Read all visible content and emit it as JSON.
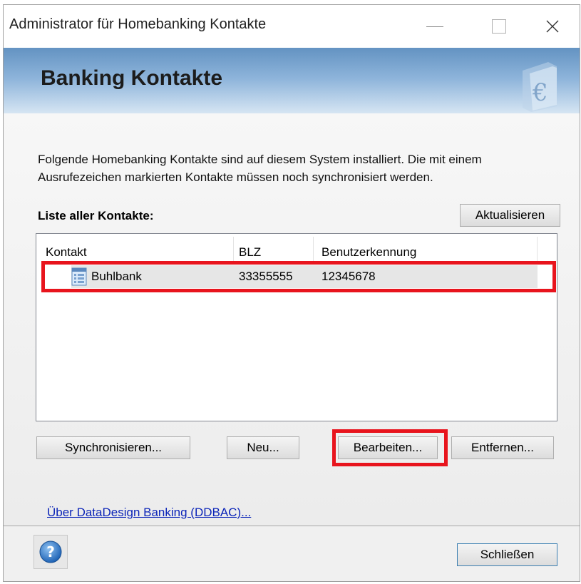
{
  "window": {
    "title": "Administrator für Homebanking Kontakte",
    "controls": {
      "minimize_icon": "minimize-icon",
      "maximize_icon": "maximize-icon",
      "close_icon": "close-icon"
    }
  },
  "header": {
    "title": "Banking Kontakte",
    "logo_icon": "euro-document-icon"
  },
  "intro_text": "Folgende Homebanking Kontakte sind auf diesem System installiert. Die mit einem Ausrufezeichen markierten Kontakte müssen noch synchronisiert werden.",
  "list": {
    "label": "Liste aller Kontakte:",
    "refresh_label": "Aktualisieren",
    "columns": [
      "Kontakt",
      "BLZ",
      "Benutzerkennung"
    ],
    "rows": [
      {
        "contact": "Buhlbank",
        "blz": "33355555",
        "user_id": "12345678",
        "icon": "contact-card-icon"
      }
    ]
  },
  "actions": {
    "sync_label": "Synchronisieren...",
    "new_label": "Neu...",
    "edit_label": "Bearbeiten...",
    "remove_label": "Entfernen..."
  },
  "about_link": "Über DataDesign Banking (DDBAC)...",
  "footer": {
    "close_label": "Schließen",
    "help_icon": "help-icon"
  },
  "colors": {
    "highlight": "#e8141d",
    "header_top": "#6393c2",
    "link": "#0b24b8"
  }
}
